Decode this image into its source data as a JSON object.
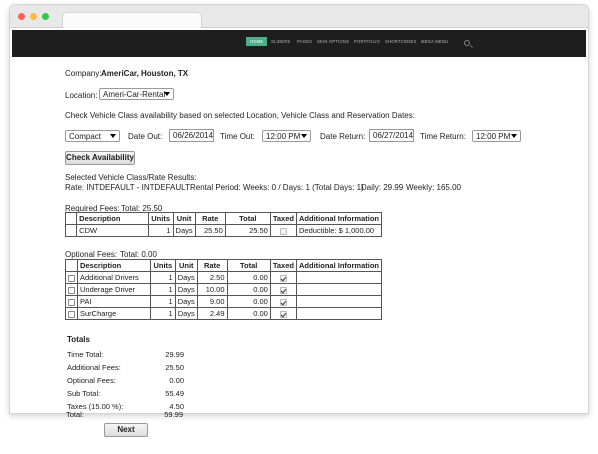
{
  "nav": {
    "items": [
      "HOME",
      "SLIDERS",
      "PAGES",
      "SKIN OPTIONS",
      "PORTFOLIO",
      "SHORTCODES",
      "MEGA MENU"
    ]
  },
  "company": {
    "label": "Company:",
    "value": "AmeriCar, Houston, TX"
  },
  "location": {
    "label": "Location:",
    "value": "Ameri-Car-Rental"
  },
  "instructions": "Check Vehicle Class availability based on selected Location, Vehicle Class and Reservation Dates:",
  "search": {
    "vehicle_class": "Compact",
    "date_out_label": "Date Out:",
    "date_out": "06/26/2014",
    "time_out_label": "Time Out:",
    "time_out": "12:00 PM",
    "date_return_label": "Date Return:",
    "date_return": "06/27/2014",
    "time_return_label": "Time Return:",
    "time_return": "12:00 PM",
    "check_button": "Check Availability"
  },
  "results": {
    "heading": "Selected Vehicle Class/Rate Results:",
    "rate_line": "Rate: INTDEFAULT - INTDEFAULT",
    "period_line": "Rental Period: Weeks: 0 / Days: 1 (Total Days: 1)",
    "daily": "Daily: 29.99",
    "weekly": "Weekly: 165.00"
  },
  "required_fees": {
    "title": "Required Fees:",
    "total": "Total: 25.50",
    "headers": [
      "Description",
      "Units",
      "Unit",
      "Rate",
      "Total",
      "Taxed",
      "Additional Information"
    ],
    "rows": [
      {
        "description": "CDW",
        "units": "1",
        "unit": "Days",
        "rate": "25.50",
        "total": "25.50",
        "taxed": false,
        "info": "Deductible: $ 1,000.00"
      }
    ]
  },
  "optional_fees": {
    "title": "Optional Fees:",
    "total": "Total: 0.00",
    "headers": [
      "Description",
      "Units",
      "Unit",
      "Rate",
      "Total",
      "Taxed",
      "Additional Information"
    ],
    "rows": [
      {
        "description": "Additional Drivers",
        "units": "1",
        "unit": "Days",
        "rate": "2.50",
        "total": "0.00",
        "taxed": true,
        "info": ""
      },
      {
        "description": "Underage Driver",
        "units": "1",
        "unit": "Days",
        "rate": "10.00",
        "total": "0.00",
        "taxed": true,
        "info": ""
      },
      {
        "description": "PAI",
        "units": "1",
        "unit": "Days",
        "rate": "9.00",
        "total": "0.00",
        "taxed": true,
        "info": ""
      },
      {
        "description": "SurCharge",
        "units": "1",
        "unit": "Days",
        "rate": "2.49",
        "total": "0.00",
        "taxed": true,
        "info": ""
      }
    ]
  },
  "totals": {
    "title": "Totals",
    "rows": [
      {
        "label": "Time Total:",
        "value": "29.99"
      },
      {
        "label": "Additional Fees:",
        "value": "25.50"
      },
      {
        "label": "Optional Fees:",
        "value": "0.00"
      },
      {
        "label": "Sub Total:",
        "value": "55.49"
      },
      {
        "label": "Taxes (15.00 %):",
        "value": "4.50"
      },
      {
        "label": "Total:",
        "value": "59.99"
      }
    ]
  },
  "next_button": "Next",
  "colors": {
    "nav_bg": "#1e1e1e",
    "nav_active": "#4caf8a",
    "dot_red": "#fc605c",
    "dot_yellow": "#fdbc40",
    "dot_green": "#34c84a"
  }
}
